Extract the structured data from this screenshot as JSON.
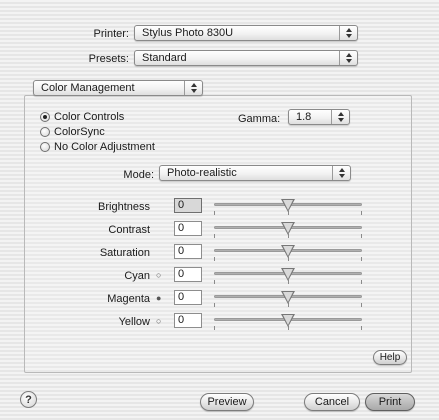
{
  "header": {
    "printer_label": "Printer:",
    "printer_value": "Stylus Photo 830U",
    "presets_label": "Presets:",
    "presets_value": "Standard"
  },
  "panel_menu": {
    "value": "Color Management"
  },
  "color_mode": {
    "options": [
      {
        "label": "Color Controls",
        "selected": true
      },
      {
        "label": "ColorSync",
        "selected": false
      },
      {
        "label": "No Color Adjustment",
        "selected": false
      }
    ],
    "gamma_label": "Gamma:",
    "gamma_value": "1.8"
  },
  "mode": {
    "label": "Mode:",
    "value": "Photo-realistic"
  },
  "adjustments": [
    {
      "label": "Brightness",
      "value": "0",
      "swatch": "",
      "level": 0.5
    },
    {
      "label": "Contrast",
      "value": "0",
      "swatch": "",
      "level": 0.5
    },
    {
      "label": "Saturation",
      "value": "0",
      "swatch": "",
      "level": 0.5
    },
    {
      "label": "Cyan",
      "value": "0",
      "swatch": "○",
      "level": 0.5
    },
    {
      "label": "Magenta",
      "value": "0",
      "swatch": "●",
      "level": 0.5
    },
    {
      "label": "Yellow",
      "value": "0",
      "swatch": "○",
      "level": 0.5
    }
  ],
  "buttons": {
    "help": "Help",
    "help_icon": "?",
    "preview": "Preview",
    "cancel": "Cancel",
    "print": "Print"
  }
}
